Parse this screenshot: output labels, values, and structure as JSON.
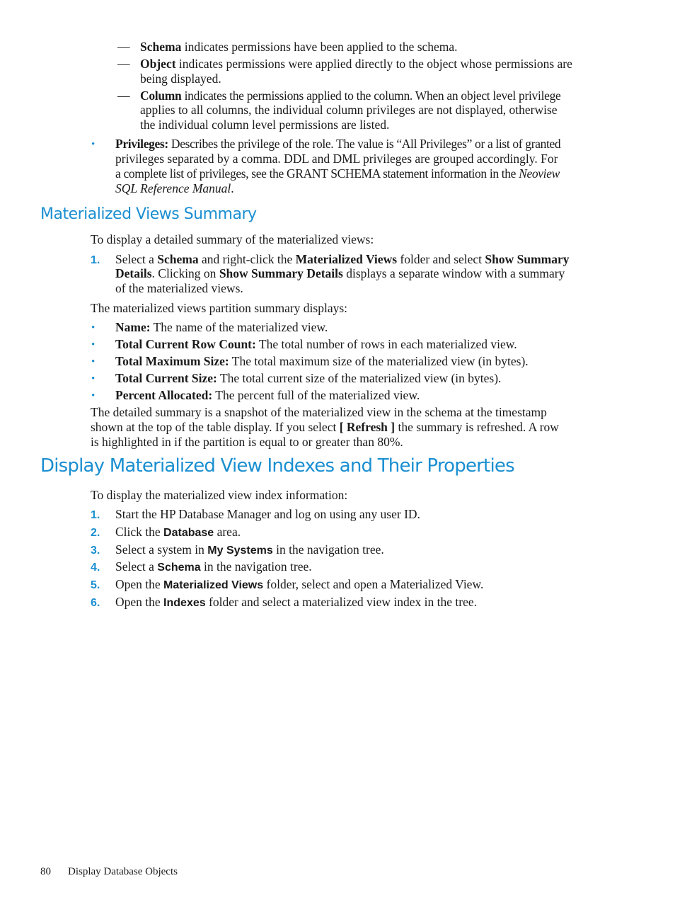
{
  "top_list": [
    {
      "term": "Schema",
      "lines": [
        " indicates permissions have been applied to the schema."
      ]
    },
    {
      "term": "Object",
      "lines": [
        " indicates permissions were applied directly to the object whose permissions are",
        "being displayed."
      ]
    },
    {
      "term": "Column",
      "lines": [
        " indicates the permissions applied to the column. When an object level privilege",
        "applies to all columns, the individual column privileges are not displayed, otherwise",
        "the individual column level permissions are listed."
      ]
    }
  ],
  "dash_glyph": "—",
  "bullet_glyph": "•",
  "privileges": {
    "term": "Privileges:",
    "line1": " Describes the privilege of the role. The value is “All Privileges” or a list of granted",
    "line2": "privileges separated by a comma. DDL and DML privileges are grouped accordingly. For",
    "line3": "a complete list of privileges, see the GRANT SCHEMA statement information in the ",
    "line3_italic": "Neoview",
    "line4_italic": "SQL Reference Manual",
    "line4_end": "."
  },
  "mv_summary": {
    "heading": "Materialized Views Summary",
    "intro": "To display a detailed summary of the materialized views:",
    "step1": {
      "num": "1.",
      "a": "Select a ",
      "b1": "Schema",
      "c": " and right-click the ",
      "b2": "Materialized Views",
      "d": " folder and select ",
      "b3": "Show Summary",
      "b4": "Details",
      "e": ". Clicking on ",
      "b5": "Show Summary Details",
      "f": " displays a separate window with a summary",
      "g": "of the materialized views."
    },
    "displays_intro": "The materialized views partition summary displays:",
    "fields": [
      {
        "term": "Name:",
        "desc": " The name of the materialized view."
      },
      {
        "term": "Total Current Row Count:",
        "desc": " The total number of rows in each materialized view."
      },
      {
        "term": "Total Maximum Size:",
        "desc": " The total maximum size of the materialized view (in bytes)."
      },
      {
        "term": "Total Current Size:",
        "desc": " The total current size of the materialized view (in bytes)."
      },
      {
        "term": "Percent Allocated:",
        "desc": " The percent full of the materialized view."
      }
    ],
    "para": {
      "l1": "The detailed summary is a snapshot of the materialized view in the schema at the timestamp",
      "l2a": "shown at the top of the table display. If you select ",
      "l2b": "[ Refresh ]",
      "l2c": " the summary is refreshed. A row",
      "l3": "is highlighted in if the partition is equal to or greater than 80%."
    }
  },
  "mv_indexes": {
    "heading": "Display Materialized View Indexes and Their Properties",
    "intro": "To display the materialized view index information:",
    "steps": [
      {
        "num": "1.",
        "pre": "Start the HP Database Manager and log on using any user ID.",
        "bold": "",
        "post": ""
      },
      {
        "num": "2.",
        "pre": "Click the ",
        "bold": "Database",
        "post": " area."
      },
      {
        "num": "3.",
        "pre": "Select a system in ",
        "bold": "My Systems",
        "post": " in the navigation tree."
      },
      {
        "num": "4.",
        "pre": "Select a ",
        "bold": "Schema",
        "post": " in the navigation tree."
      },
      {
        "num": "5.",
        "pre": "Open the ",
        "bold": "Materialized Views",
        "post": " folder, select and open a Materialized View."
      },
      {
        "num": "6.",
        "pre": "Open the ",
        "bold": "Indexes",
        "post": " folder and select a materialized view index in the tree."
      }
    ]
  },
  "footer": {
    "page_number": "80",
    "section": "Display Database Objects"
  },
  "colors": {
    "accent": "#1a8fd1",
    "text": "#1a1a1a"
  }
}
